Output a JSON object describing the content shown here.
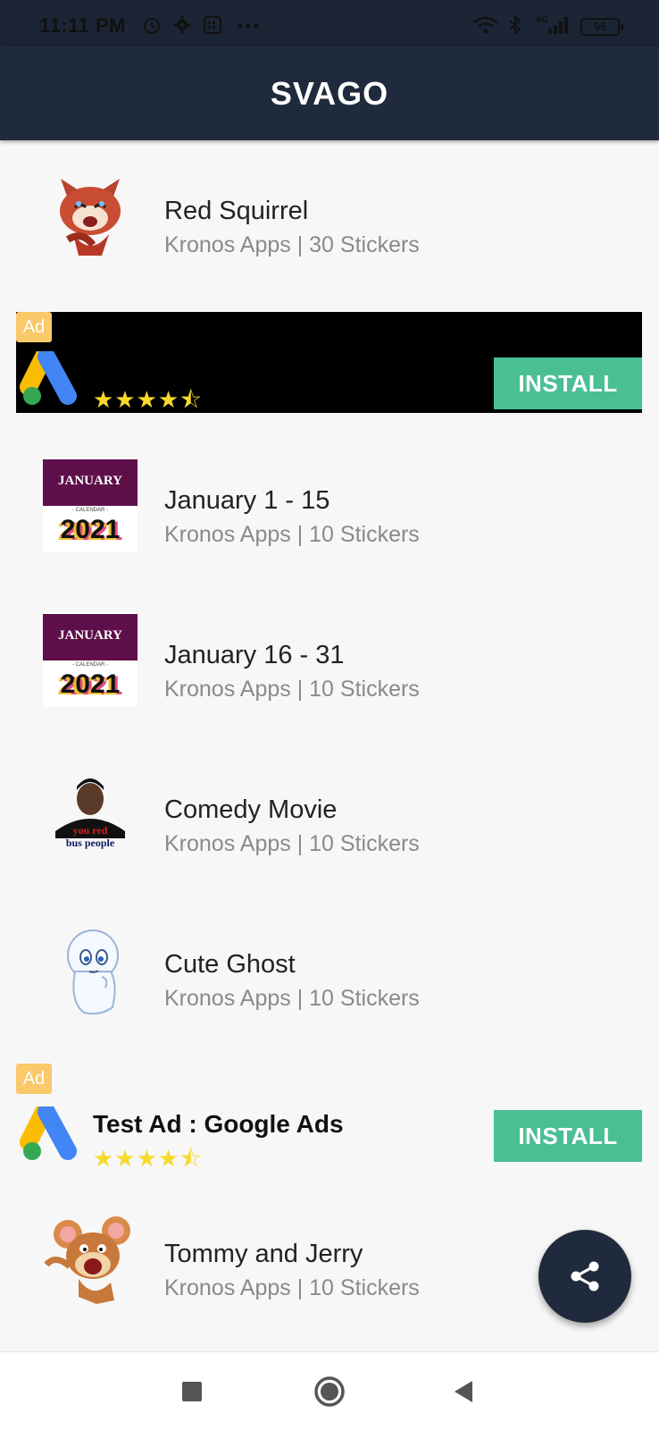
{
  "status_bar": {
    "time": "11:11 PM",
    "battery": "95",
    "icons": [
      "alarm-icon",
      "settings-icon",
      "calendar-icon",
      "more-dots-icon",
      "wifi-icon",
      "bluetooth-icon",
      "signal-4g-icon",
      "battery-icon"
    ]
  },
  "app_bar": {
    "title": "SVAGO"
  },
  "packs": [
    {
      "title": "Red Squirrel",
      "subtitle": "Kronos Apps | 30 Stickers",
      "thumb_icon": "red-panda-sticker-icon"
    },
    {
      "title": "January 1 - 15",
      "subtitle": "Kronos Apps | 10 Stickers",
      "thumb_icon": "january-calendar-icon",
      "thumb_text": {
        "month": "JANUARY",
        "caption": "- CALENDAR -",
        "year": "2021"
      }
    },
    {
      "title": "January 16 - 31",
      "subtitle": "Kronos Apps | 10 Stickers",
      "thumb_icon": "january-calendar-icon",
      "thumb_text": {
        "month": "JANUARY",
        "caption": "- CALENDAR -",
        "year": "2021"
      }
    },
    {
      "title": "Comedy Movie",
      "subtitle": "Kronos Apps | 10 Stickers",
      "thumb_icon": "comedy-man-sticker-icon",
      "thumb_text": {
        "line1": "you red",
        "line2": "bus people"
      }
    },
    {
      "title": "Cute Ghost",
      "subtitle": "Kronos Apps | 10 Stickers",
      "thumb_icon": "ghost-sticker-icon"
    },
    {
      "title": "Tommy and Jerry",
      "subtitle": "Kronos Apps | 10 Stickers",
      "thumb_icon": "mouse-sticker-icon"
    }
  ],
  "ads": {
    "badge": "Ad",
    "banner": {
      "install_label": "INSTALL",
      "rating": 4.5,
      "stars": "★★★★⯪"
    },
    "native": {
      "title": "Test Ad : Google Ads",
      "install_label": "INSTALL",
      "rating": 4.5,
      "stars": "★★★★⯪"
    }
  },
  "fab": {
    "icon": "share-icon"
  },
  "nav_bar": {
    "buttons": [
      "recents-square-icon",
      "home-circle-icon",
      "back-triangle-icon"
    ]
  },
  "colors": {
    "app_bar": "#1f2a3c",
    "install_button": "#4bbf94",
    "ad_badge": "#f9c96a",
    "star": "#f7d92a",
    "subtitle": "#8a8a8a"
  }
}
